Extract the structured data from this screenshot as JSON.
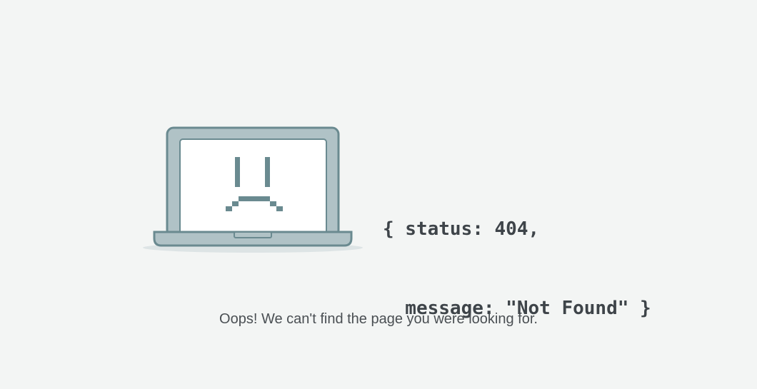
{
  "error": {
    "code_line_1": "{ status: 404,",
    "code_line_2": "  message: \"Not Found\" }",
    "message": "Oops! We can't find the page you were looking for."
  },
  "colors": {
    "background": "#f3f5f4",
    "laptop_body": "#b0c2c6",
    "laptop_outline": "#6a8a90",
    "screen": "#ffffff",
    "face": "#6a8a90",
    "text": "#3e4449"
  },
  "icons": {
    "illustration": "sad-laptop-icon"
  }
}
